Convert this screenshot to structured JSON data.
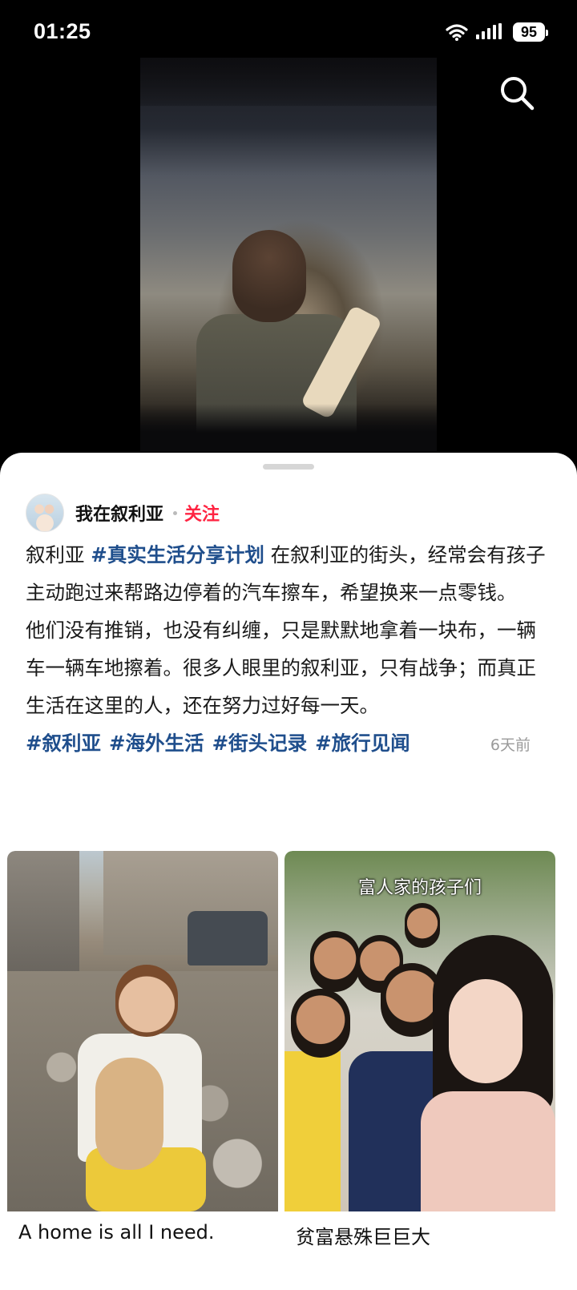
{
  "status": {
    "time": "01:25",
    "battery": "95"
  },
  "video": {
    "description_icon": "video-frame"
  },
  "post": {
    "author": "我在叙利亚",
    "follow_label": "关注",
    "separator": "·",
    "paragraph1_prefix": "叙利亚 ",
    "paragraph1_tag": "#真实生活分享计划",
    "paragraph1_rest": " 在叙利亚的街头，经常会有孩子主动跑过来帮路边停着的汽车擦车，希望换来一点零钱。",
    "paragraph2": "他们没有推销，也没有纠缠，只是默默地拿着一块布，一辆车一辆车地擦着。很多人眼里的叙利亚，只有战争；而真正生活在这里的人，还在努力过好每一天。",
    "tags": [
      "#叙利亚",
      "#海外生活",
      "#街头记录",
      "#旅行见闻"
    ],
    "date": "6天前"
  },
  "cards": [
    {
      "title": "A home is all I need."
    },
    {
      "title": "贫富悬殊巨巨大",
      "image_caption": "富人家的孩子们"
    }
  ]
}
